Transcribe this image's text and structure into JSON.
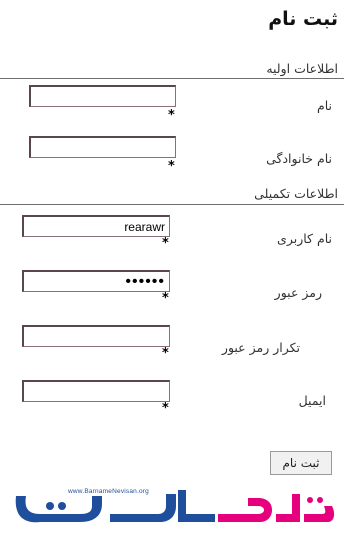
{
  "form": {
    "title": "ثبت نام",
    "sections": [
      {
        "title": "اطلاعات اولیه"
      },
      {
        "title": "اطلاعات تکمیلی"
      }
    ],
    "fields": [
      {
        "label": "نام",
        "value": "",
        "required_mark": "*"
      },
      {
        "label": "نام خانوادگی",
        "value": "",
        "required_mark": "*"
      },
      {
        "label": "نام کاربری",
        "value": "rearawr",
        "required_mark": "*"
      },
      {
        "label": "رمز عبور",
        "value": "••••••",
        "required_mark": "*"
      },
      {
        "label": "تکرار رمز عبور",
        "value": "",
        "required_mark": "*"
      },
      {
        "label": "ایمیل",
        "value": "",
        "required_mark": "*"
      }
    ],
    "submit_label": "ثبت نام"
  },
  "logo": {
    "site_url": "www.BarnameNevisan.org",
    "name": "برنامه نویسان",
    "colors": {
      "pink": "#e6007e",
      "blue": "#1f4e9c"
    }
  }
}
